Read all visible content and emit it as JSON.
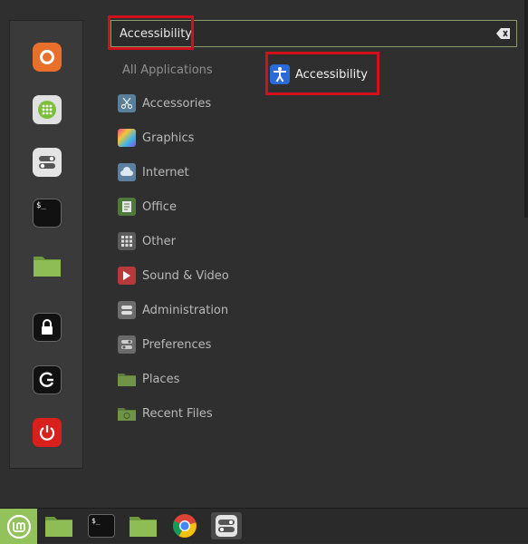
{
  "search": {
    "value": "Accessibility",
    "clear_icon": "backspace-icon"
  },
  "categories": {
    "all_applications": "All Applications",
    "items": [
      {
        "label": "Accessories",
        "icon": "scissors-icon"
      },
      {
        "label": "Graphics",
        "icon": "palette-icon"
      },
      {
        "label": "Internet",
        "icon": "cloud-icon"
      },
      {
        "label": "Office",
        "icon": "document-icon"
      },
      {
        "label": "Other",
        "icon": "grid-icon"
      },
      {
        "label": "Sound & Video",
        "icon": "play-icon"
      },
      {
        "label": "Administration",
        "icon": "admin-icon"
      },
      {
        "label": "Preferences",
        "icon": "toggle-icon"
      },
      {
        "label": "Places",
        "icon": "folder-icon"
      },
      {
        "label": "Recent Files",
        "icon": "recent-folder-icon"
      }
    ]
  },
  "results": [
    {
      "label": "Accessibility",
      "icon": "accessibility-icon"
    }
  ],
  "favorites": [
    {
      "name": "Firefox",
      "icon": "firefox-icon"
    },
    {
      "name": "Software Manager",
      "icon": "software-manager-icon"
    },
    {
      "name": "System Settings",
      "icon": "settings-toggle-icon"
    },
    {
      "name": "Terminal",
      "icon": "terminal-icon",
      "glyph": "$_"
    },
    {
      "name": "Files",
      "icon": "folder-icon"
    },
    {
      "name": "Lock Screen",
      "icon": "lock-icon"
    },
    {
      "name": "Logout",
      "icon": "logout-icon"
    },
    {
      "name": "Quit",
      "icon": "power-icon"
    }
  ],
  "taskbar": {
    "items": [
      {
        "name": "Menu",
        "icon": "mint-logo-icon"
      },
      {
        "name": "Show Desktop",
        "icon": "desktop-folder-icon"
      },
      {
        "name": "Terminal",
        "icon": "terminal-icon",
        "glyph": "$_"
      },
      {
        "name": "Files",
        "icon": "folder-icon"
      },
      {
        "name": "Chrome",
        "icon": "chrome-icon"
      },
      {
        "name": "System Settings",
        "icon": "settings-toggle-icon"
      }
    ]
  },
  "colors": {
    "highlight": "#d0101c",
    "mint_green": "#93c25c",
    "accent_blue": "#2b6bd8"
  }
}
